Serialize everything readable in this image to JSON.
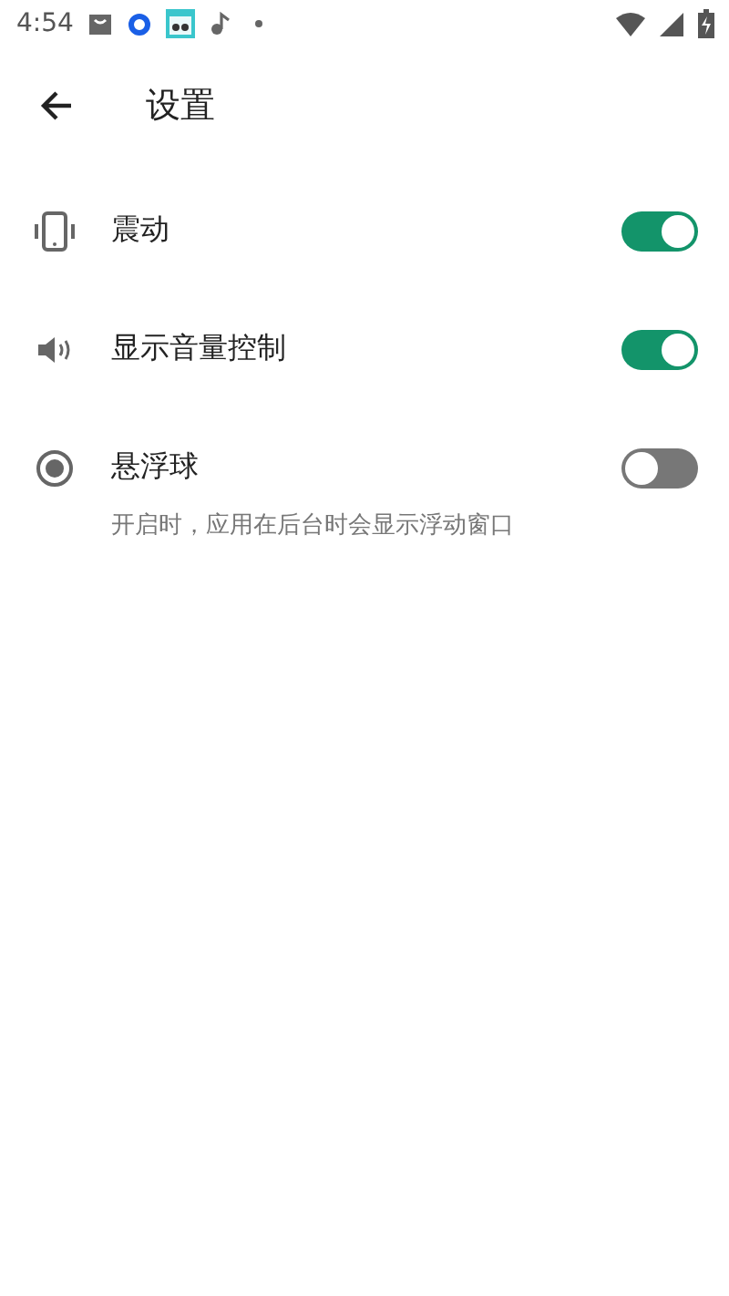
{
  "status_bar": {
    "time": "4:54"
  },
  "toolbar": {
    "title": "设置"
  },
  "settings": [
    {
      "kind": "vibrate",
      "label": "震动",
      "on": true
    },
    {
      "kind": "volume",
      "label": "显示音量控制",
      "on": true
    },
    {
      "kind": "bubble",
      "label": "悬浮球",
      "on": false,
      "description": "开启时，应用在后台时会显示浮动窗口"
    }
  ]
}
